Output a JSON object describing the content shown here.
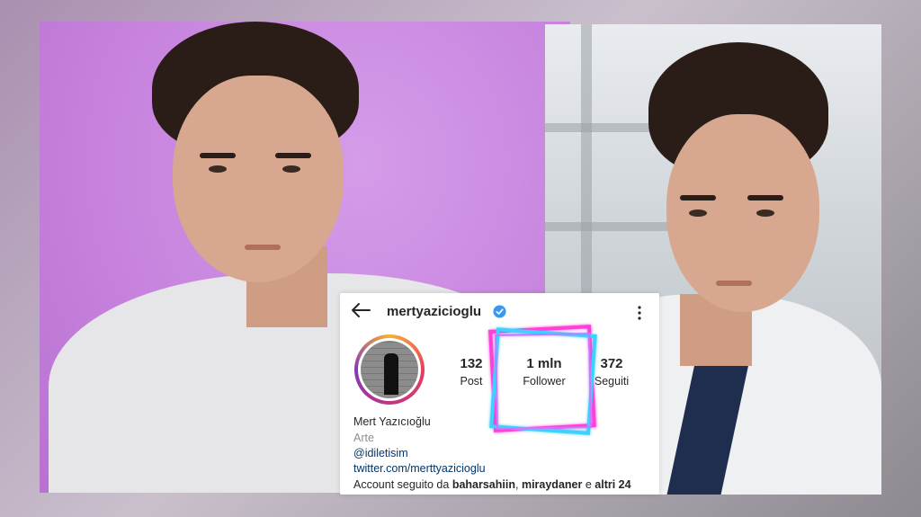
{
  "profile": {
    "username": "mertyazicioglu",
    "full_name": "Mert Yazıcıoğlu",
    "category": "Arte",
    "handle": "@idiletisim",
    "link": "twitter.com/merttyazicioglu",
    "followed_by_prefix": "Account seguito da",
    "followed_by_user1": "baharsahiin",
    "separator": ",",
    "followed_by_user2": "miraydaner",
    "conjunction": "e",
    "followed_by_others": "altri 24"
  },
  "stats": {
    "posts_count": "132",
    "posts_label": "Post",
    "followers_count": "1 mln",
    "followers_label": "Follower",
    "following_count": "372",
    "following_label": "Seguiti"
  },
  "icons": {
    "back": "arrow-left-icon",
    "verified": "verified-badge-icon",
    "more": "vertical-dots-icon"
  },
  "colors": {
    "verified": "#3897f0",
    "link": "#00376b",
    "neon_blue": "#3fd0ff",
    "neon_pink": "#ff3fd8"
  }
}
